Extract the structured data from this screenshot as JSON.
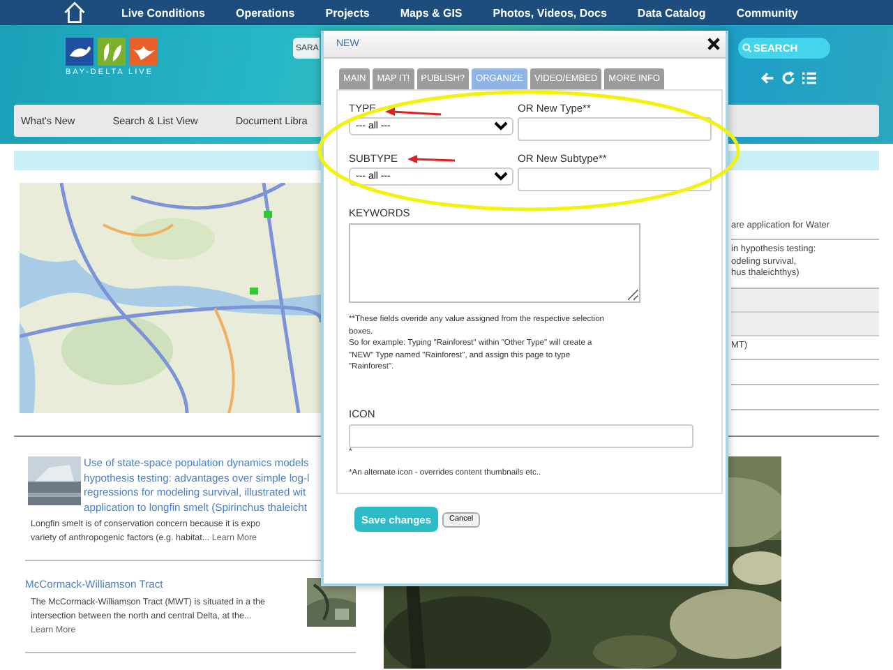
{
  "nav": [
    {
      "label": "Live Conditions"
    },
    {
      "label": "Operations"
    },
    {
      "label": "Projects"
    },
    {
      "label": "Maps & GIS"
    },
    {
      "label": "Photos, Videos, Docs"
    },
    {
      "label": "Data Catalog"
    },
    {
      "label": "Community"
    }
  ],
  "logo": {
    "text": "BAY-DELTA LIVE"
  },
  "search": {
    "value": "SARA",
    "button": "SEARCH"
  },
  "menu": [
    "What's New",
    "Search & List View",
    "Document Libra"
  ],
  "right_column": [
    "are application for Water",
    "in hypothesis testing:\nodeling survival,\nhus thaleichthys)",
    "MT)"
  ],
  "articles": [
    {
      "title": "Use of state-space population dynamics models\nhypothesis testing: advantages over simple log-l\nregressions for modeling survival, illustrated wit\napplication to longfin smelt (Spirinchus thaleicht",
      "summary": "Longfin smelt is of conservation concern because it is expo\nvariety of anthropogenic factors (e.g. habitat...",
      "link": "Learn More"
    },
    {
      "title": "McCormack-Williamson Tract",
      "summary": "The McCormack-Williamson Tract (MWT) is situated in a the\nintersection between the north and central Delta, at the...",
      "link": "Learn More"
    }
  ],
  "dialog": {
    "title": "NEW",
    "tabs": [
      {
        "label": "MAIN",
        "selected": false
      },
      {
        "label": "MAP IT!",
        "selected": false
      },
      {
        "label": "PUBLISH?",
        "selected": false
      },
      {
        "label": "ORGANIZE",
        "selected": true
      },
      {
        "label": "VIDEO/EMBED",
        "selected": false
      },
      {
        "label": "MORE INFO",
        "selected": false
      }
    ],
    "type": {
      "label": "TYPE",
      "value": "--- all ---"
    },
    "new_type": {
      "label": "OR New Type**"
    },
    "subtype": {
      "label": "SUBTYPE",
      "value": "--- all ---"
    },
    "new_subtype": {
      "label": "OR New Subtype**"
    },
    "keywords": {
      "label": "KEYWORDS"
    },
    "note": "**These fields overide any value assigned from the respective selection\nboxes.\nSo for example: Typing \"Rainforest\" within \"Other Type\" will create a\n\"NEW\" Type named \"Rainforest\", and assign this page to type\n\"Rainforest\".",
    "icon": {
      "label": "ICON",
      "mark": "*",
      "note": "*An alternate icon - overrides content thumbnails etc.."
    },
    "buttons": [
      {
        "label": "Save changes",
        "kind": "primary"
      },
      {
        "label": "Cancel",
        "kind": "default"
      }
    ]
  }
}
